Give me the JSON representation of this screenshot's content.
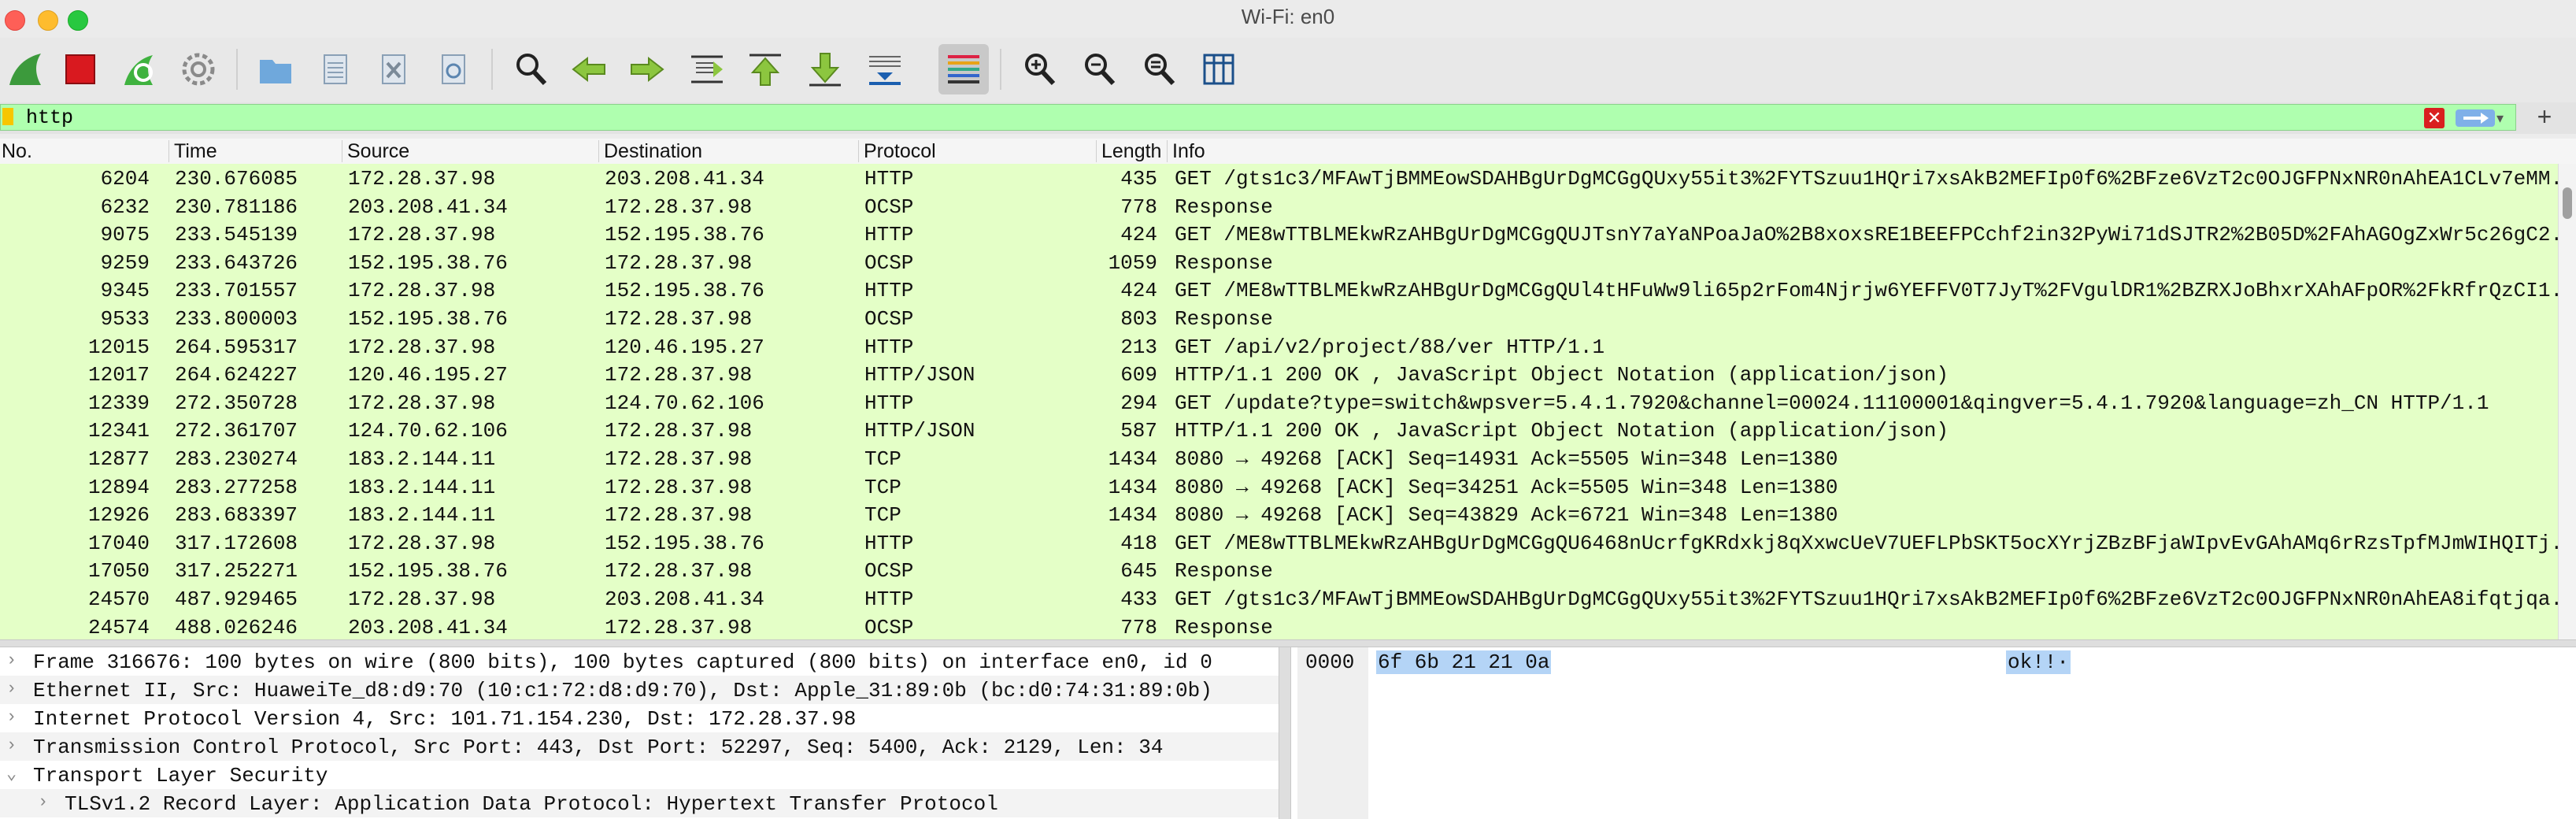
{
  "window": {
    "title": "Wi-Fi: en0"
  },
  "toolbar": {
    "buttons": [
      {
        "icon": "shark-fin-icon",
        "label": "Start capturing packets"
      },
      {
        "icon": "stop-icon",
        "label": "Stop capturing packets"
      },
      {
        "icon": "restart-capture-icon",
        "label": "Restart current capture"
      },
      {
        "icon": "gear-icon",
        "label": "Capture options"
      },
      {
        "icon": "folder-icon",
        "label": "Open"
      },
      {
        "icon": "document-icon",
        "label": "Save"
      },
      {
        "icon": "close-file-icon",
        "label": "Close"
      },
      {
        "icon": "reload-icon",
        "label": "Reload"
      },
      {
        "icon": "search-icon",
        "label": "Find packet"
      },
      {
        "icon": "arrow-left-icon",
        "label": "Go back"
      },
      {
        "icon": "arrow-right-icon",
        "label": "Go forward"
      },
      {
        "icon": "go-to-packet-icon",
        "label": "Go to packet"
      },
      {
        "icon": "go-first-icon",
        "label": "Go to first packet"
      },
      {
        "icon": "go-last-icon",
        "label": "Go to last packet"
      },
      {
        "icon": "autoscroll-icon",
        "label": "Auto scroll"
      },
      {
        "icon": "colorize-icon",
        "label": "Colorize packet list"
      },
      {
        "icon": "zoom-in-icon",
        "label": "Zoom in"
      },
      {
        "icon": "zoom-out-icon",
        "label": "Zoom out"
      },
      {
        "icon": "zoom-normal-icon",
        "label": "Normal size"
      },
      {
        "icon": "resize-columns-icon",
        "label": "Resize columns"
      }
    ]
  },
  "filter": {
    "value": "http",
    "plus": "+"
  },
  "packet_list": {
    "columns": [
      "No.",
      "Time",
      "Source",
      "Destination",
      "Protocol",
      "Length",
      "Info"
    ],
    "rows": [
      {
        "no": "6204",
        "time": "230.676085",
        "src": "172.28.37.98",
        "dst": "203.208.41.34",
        "proto": "HTTP",
        "len": "435",
        "info": "GET /gts1c3/MFAwTjBMMEowSDAHBgUrDgMCGgQUxy55it3%2FYTSzuu1HQri7xsAkB2MEFIp0f6%2BFze6VzT2c0OJGFPNxNR0nAhEA1CLv7eMM."
      },
      {
        "no": "6232",
        "time": "230.781186",
        "src": "203.208.41.34",
        "dst": "172.28.37.98",
        "proto": "OCSP",
        "len": "778",
        "info": "Response"
      },
      {
        "no": "9075",
        "time": "233.545139",
        "src": "172.28.37.98",
        "dst": "152.195.38.76",
        "proto": "HTTP",
        "len": "424",
        "info": "GET /ME8wTTBLMEkwRzAHBgUrDgMCGgQUJTsnY7aYaNPoaJaO%2B8xoxsRE1BEEFPCchf2in32PyWi71dSJTR2%2B05D%2FAhAGOgZxWr5c26gC2."
      },
      {
        "no": "9259",
        "time": "233.643726",
        "src": "152.195.38.76",
        "dst": "172.28.37.98",
        "proto": "OCSP",
        "len": "1059",
        "info": "Response"
      },
      {
        "no": "9345",
        "time": "233.701557",
        "src": "172.28.37.98",
        "dst": "152.195.38.76",
        "proto": "HTTP",
        "len": "424",
        "info": "GET /ME8wTTBLMEkwRzAHBgUrDgMCGgQUl4tHFuWw9li65p2rFom4Njrjw6YEFFV0T7JyT%2FVgulDR1%2BZRXJoBhxrXAhAFpOR%2FkRfrQzCI1."
      },
      {
        "no": "9533",
        "time": "233.800003",
        "src": "152.195.38.76",
        "dst": "172.28.37.98",
        "proto": "OCSP",
        "len": "803",
        "info": "Response"
      },
      {
        "no": "12015",
        "time": "264.595317",
        "src": "172.28.37.98",
        "dst": "120.46.195.27",
        "proto": "HTTP",
        "len": "213",
        "info": "GET /api/v2/project/88/ver HTTP/1.1"
      },
      {
        "no": "12017",
        "time": "264.624227",
        "src": "120.46.195.27",
        "dst": "172.28.37.98",
        "proto": "HTTP/JSON",
        "len": "609",
        "info": "HTTP/1.1 200 OK , JavaScript Object Notation (application/json)"
      },
      {
        "no": "12339",
        "time": "272.350728",
        "src": "172.28.37.98",
        "dst": "124.70.62.106",
        "proto": "HTTP",
        "len": "294",
        "info": "GET /update?type=switch&wpsver=5.4.1.7920&channel=00024.11100001&qingver=5.4.1.7920&language=zh_CN HTTP/1.1"
      },
      {
        "no": "12341",
        "time": "272.361707",
        "src": "124.70.62.106",
        "dst": "172.28.37.98",
        "proto": "HTTP/JSON",
        "len": "587",
        "info": "HTTP/1.1 200 OK , JavaScript Object Notation (application/json)"
      },
      {
        "no": "12877",
        "time": "283.230274",
        "src": "183.2.144.11",
        "dst": "172.28.37.98",
        "proto": "TCP",
        "len": "1434",
        "info": "8080 → 49268 [ACK] Seq=14931 Ack=5505 Win=348 Len=1380"
      },
      {
        "no": "12894",
        "time": "283.277258",
        "src": "183.2.144.11",
        "dst": "172.28.37.98",
        "proto": "TCP",
        "len": "1434",
        "info": "8080 → 49268 [ACK] Seq=34251 Ack=5505 Win=348 Len=1380"
      },
      {
        "no": "12926",
        "time": "283.683397",
        "src": "183.2.144.11",
        "dst": "172.28.37.98",
        "proto": "TCP",
        "len": "1434",
        "info": "8080 → 49268 [ACK] Seq=43829 Ack=6721 Win=348 Len=1380"
      },
      {
        "no": "17040",
        "time": "317.172608",
        "src": "172.28.37.98",
        "dst": "152.195.38.76",
        "proto": "HTTP",
        "len": "418",
        "info": "GET /ME8wTTBLMEkwRzAHBgUrDgMCGgQU6468nUcrfgKRdxkj8qXxwcUeV7UEFLPbSKT5ocXYrjZBzBFjaWIpvEvGAhAMq6rRzsTpfMJmWIHQITj."
      },
      {
        "no": "17050",
        "time": "317.252271",
        "src": "152.195.38.76",
        "dst": "172.28.37.98",
        "proto": "OCSP",
        "len": "645",
        "info": "Response"
      },
      {
        "no": "24570",
        "time": "487.929465",
        "src": "172.28.37.98",
        "dst": "203.208.41.34",
        "proto": "HTTP",
        "len": "433",
        "info": "GET /gts1c3/MFAwTjBMMEowSDAHBgUrDgMCGgQUxy55it3%2FYTSzuu1HQri7xsAkB2MEFIp0f6%2BFze6VzT2c0OJGFPNxNR0nAhEA8ifqtjqa."
      },
      {
        "no": "24574",
        "time": "488.026246",
        "src": "203.208.41.34",
        "dst": "172.28.37.98",
        "proto": "OCSP",
        "len": "778",
        "info": "Response"
      }
    ]
  },
  "details": {
    "items": [
      {
        "chevron": "›",
        "text": "Frame 316676: 100 bytes on wire (800 bits), 100 bytes captured (800 bits) on interface en0, id 0"
      },
      {
        "chevron": "›",
        "text": "Ethernet II, Src: HuaweiTe_d8:d9:70 (10:c1:72:d8:d9:70), Dst: Apple_31:89:0b (bc:d0:74:31:89:0b)"
      },
      {
        "chevron": "›",
        "text": "Internet Protocol Version 4, Src: 101.71.154.230, Dst: 172.28.37.98"
      },
      {
        "chevron": "›",
        "text": "Transmission Control Protocol, Src Port: 443, Dst Port: 52297, Seq: 5400, Ack: 2129, Len: 34"
      },
      {
        "chevron": "⌄",
        "text": "Transport Layer Security"
      },
      {
        "chevron": "›",
        "text": "TLSv1.2 Record Layer: Application Data Protocol: Hypertext Transfer Protocol",
        "sub": true
      }
    ]
  },
  "bytes": {
    "offset": "0000",
    "hex": "6f 6b 21 21 0a",
    "ascii": "ok!!·"
  },
  "colors": {
    "row_bg": "#e4ffc7",
    "filter_bg": "#afffaf",
    "selection": "#b4d4f6"
  }
}
